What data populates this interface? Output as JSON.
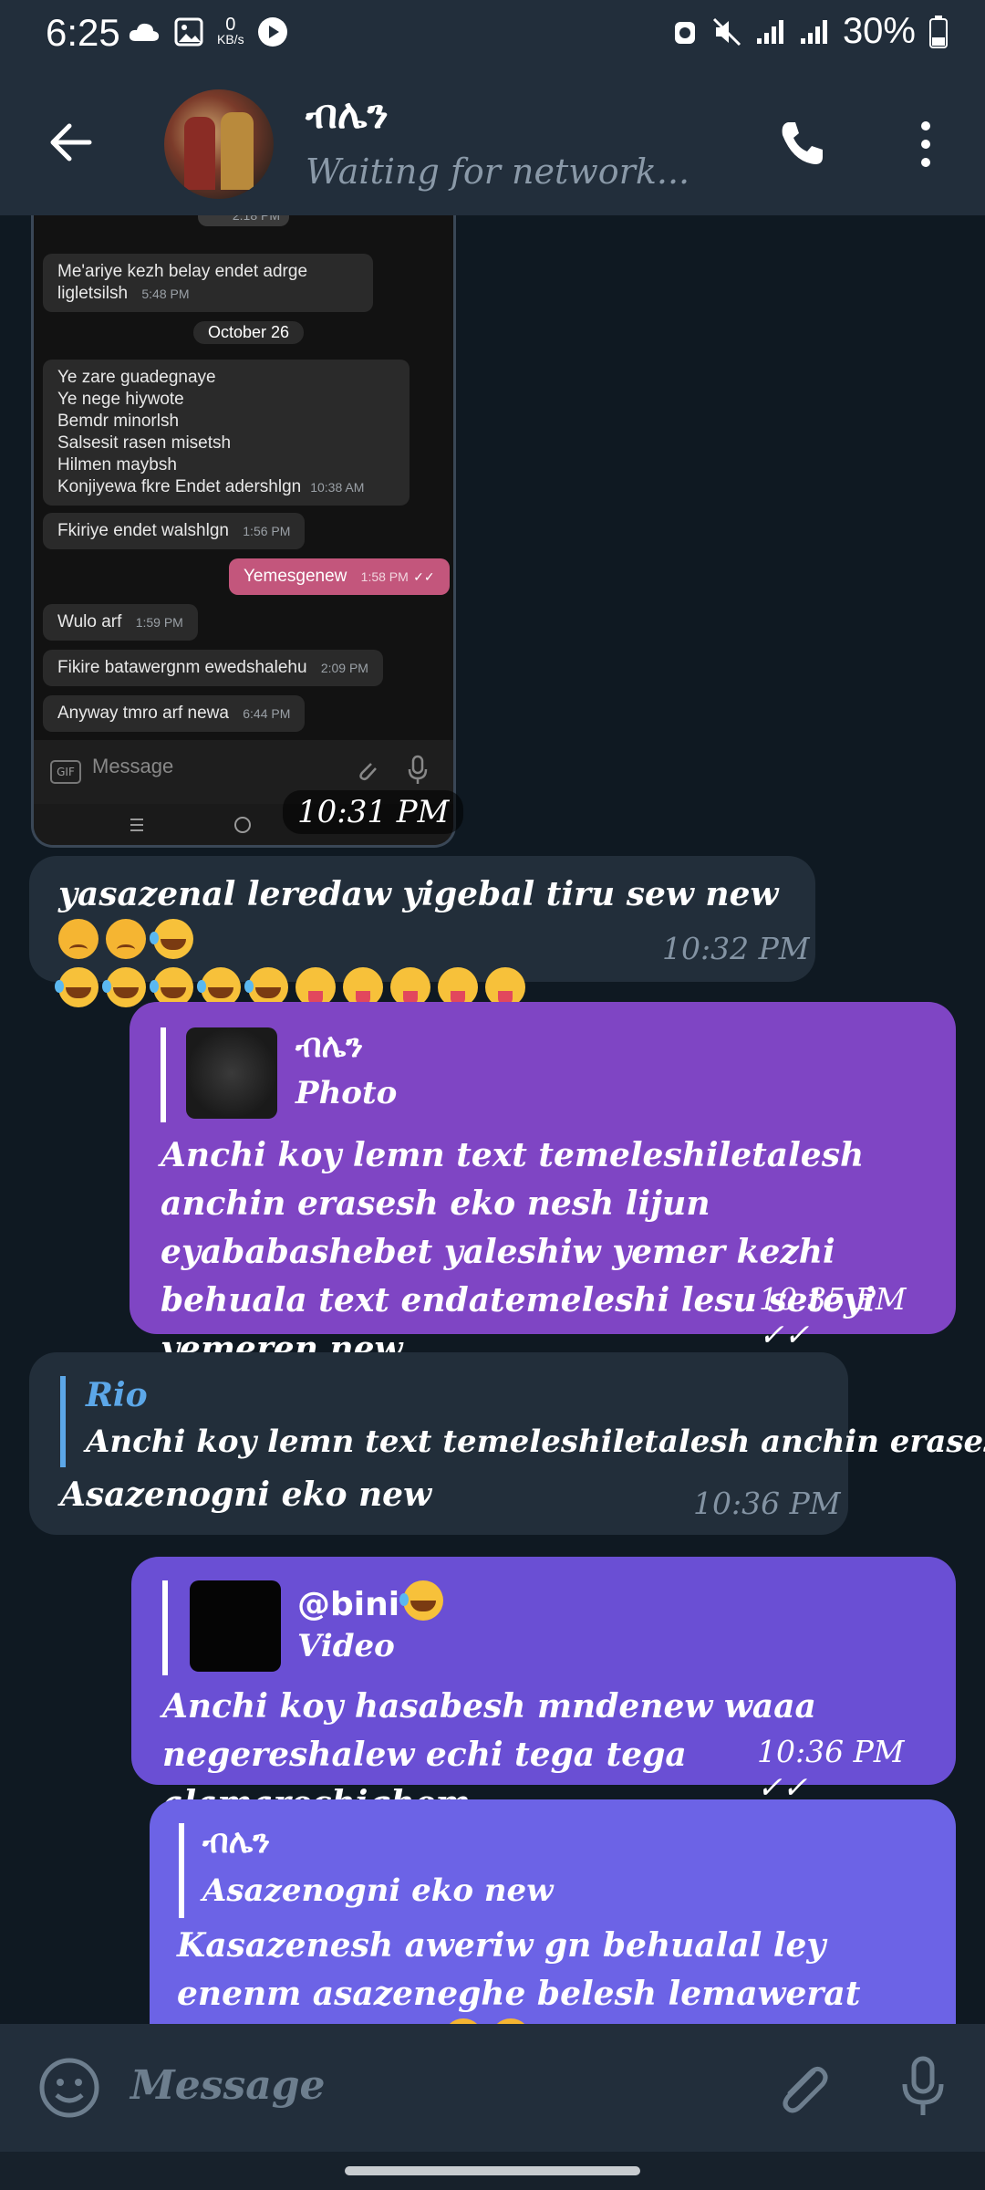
{
  "status_bar": {
    "time": "6:25",
    "net_speed": "0",
    "net_unit": "KB/s",
    "battery": "30%"
  },
  "header": {
    "contact_name": "ብሌን",
    "status": "Waiting for network..."
  },
  "screenshot": {
    "top_time": "2:18 PM",
    "m1_text": "Me'ariye kezh belay endet adrge ligletsilsh",
    "m1_time": "5:48 PM",
    "day": "October 26",
    "m2_lines": [
      "Ye zare guadegnaye",
      "Ye nege hiywote",
      "Bemdr minorlsh",
      "Salsesit rasen misetsh",
      "Hilmen maybsh",
      "Konjiyewa fkre Endet adershlgn"
    ],
    "m2_time": "10:38 AM",
    "m3_text": "Fkiriye endet walshlgn",
    "m3_time": "1:56 PM",
    "m4_text": "Yemesgenew",
    "m4_time": "1:58 PM",
    "m5_text": "Wulo arf",
    "m5_time": "1:59 PM",
    "m6_text": "Fikire batawergnm ewedshalehu",
    "m6_time": "2:09 PM",
    "m7_text": "Anyway tmro arf newa",
    "m7_time": "6:44 PM",
    "input_placeholder": "Message",
    "gif_label": "GIF",
    "sent_time": "10:31 PM"
  },
  "messages": {
    "msg1": {
      "text": "yasazenal leredaw yigebal tiru sew new",
      "time": "10:32 PM"
    },
    "msg2": {
      "reply_name": "ብሌን",
      "reply_type": "Photo",
      "text": "Anchi koy lemn text temeleshiletalesh anchin erasesh eko nesh lijun eyababashebet yaleshiw yemer kezhi behuala text endatemeleshi lesu seteyi yemeren new",
      "time": "10:35 PM"
    },
    "msg3": {
      "reply_name": "Rio",
      "reply_text": "Anchi koy lemn text temeleshiletalesh anchin erasesh...",
      "text": "Asazenogni eko new",
      "time": "10:36 PM"
    },
    "msg4": {
      "reply_name": "@bini",
      "reply_type": "Video",
      "text": "Anchi koy hasabesh mndenew waaa negereshalew echi tega tega alamarechighem",
      "time": "10:36 PM"
    },
    "msg5": {
      "reply_name": "ብሌን",
      "reply_text": "Asazenogni eko new",
      "text": "Kasazenesh aweriw gn behualal ley enenm asazeneghe belesh lemawerat endatemokeri"
    }
  },
  "composer": {
    "placeholder": "Message"
  },
  "colors": {
    "bg": "#0f1922",
    "header": "#222e3b",
    "incoming": "#222e3a",
    "outgoing": "#7f45c4",
    "accent": "#5ca7e8"
  },
  "icons": [
    "back-arrow-icon",
    "phone-icon",
    "more-vert-icon",
    "emoji-icon",
    "attach-icon",
    "mic-icon",
    "double-check-icon"
  ]
}
